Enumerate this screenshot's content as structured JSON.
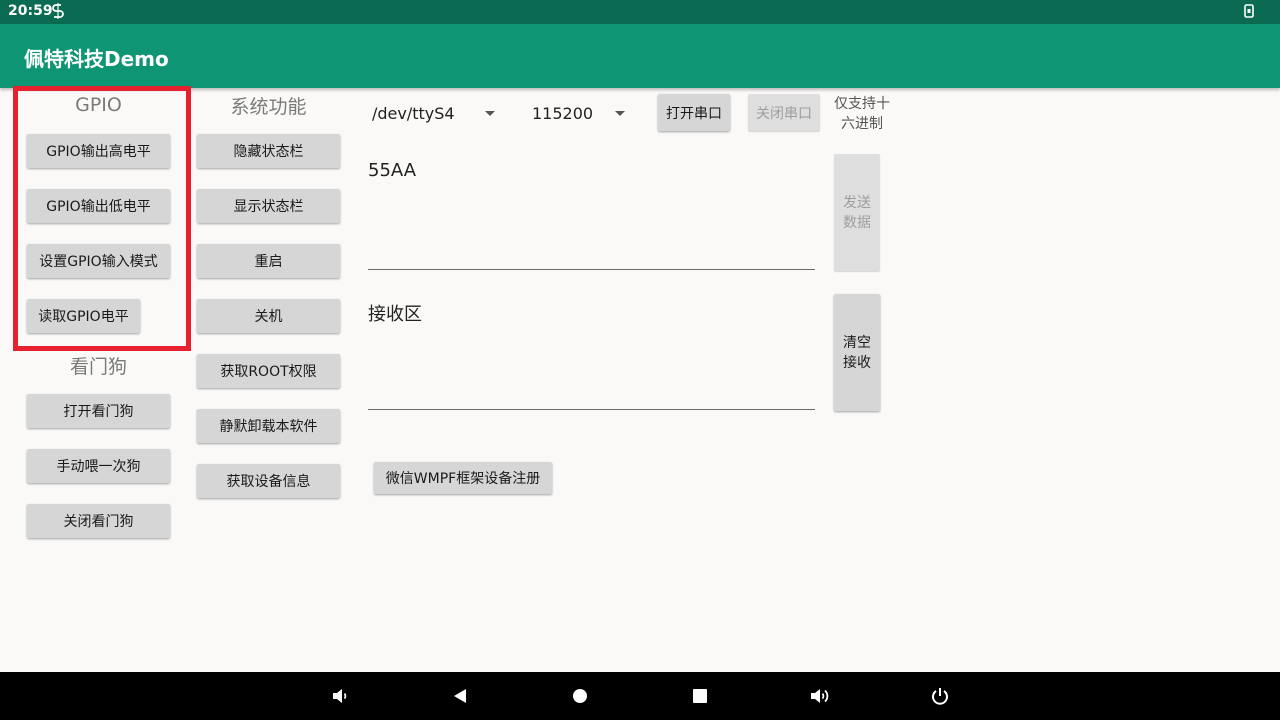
{
  "status": {
    "time": "20:59",
    "sim_glyph": "S",
    "rotate_glyph": "↻"
  },
  "app": {
    "title": "佩特科技Demo"
  },
  "gpio": {
    "title": "GPIO",
    "buttons": [
      "GPIO输出高电平",
      "GPIO输出低电平",
      "设置GPIO输入模式",
      "读取GPIO电平"
    ]
  },
  "watchdog": {
    "title": "看门狗",
    "buttons": [
      "打开看门狗",
      "手动喂一次狗",
      "关闭看门狗"
    ]
  },
  "system": {
    "title": "系统功能",
    "buttons": [
      "隐藏状态栏",
      "显示状态栏",
      "重启",
      "关机",
      "获取ROOT权限",
      "静默卸载本软件",
      "获取设备信息"
    ]
  },
  "serial": {
    "port": "/dev/ttyS4",
    "baud": "115200",
    "open_label": "打开串口",
    "close_label": "关闭串口",
    "hint": "仅支持十六进制",
    "send_value": "55AA",
    "send_label": "发送\n数据",
    "receive_placeholder": "接收区",
    "clear_label": "清空\n接收",
    "wmpf_label": "微信WMPF框架设备注册"
  },
  "nav": [
    "volume-down",
    "back",
    "home",
    "recents",
    "volume-up",
    "power"
  ]
}
